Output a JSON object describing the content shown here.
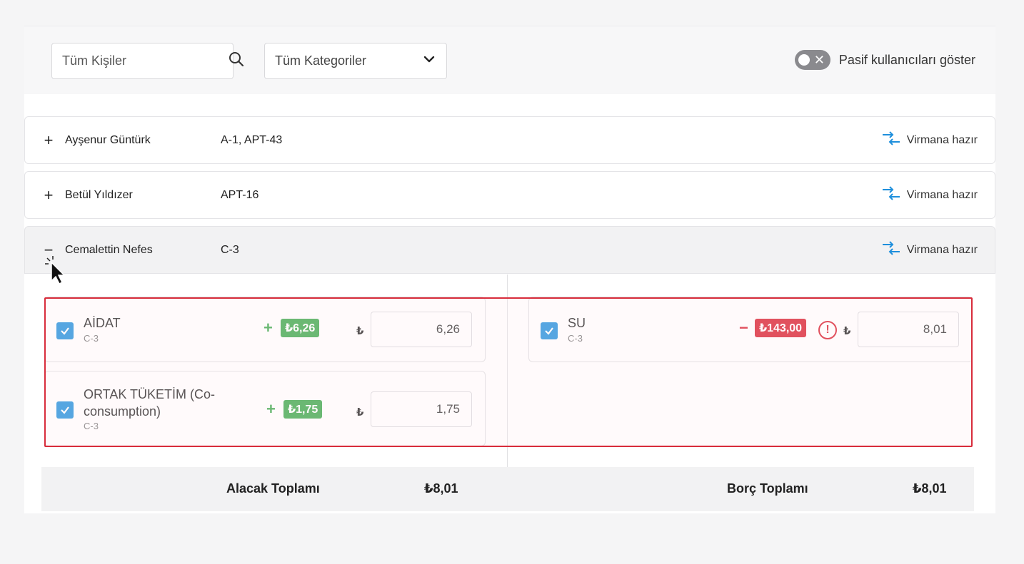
{
  "filters": {
    "search_placeholder": "Tüm Kişiler",
    "category_selected": "Tüm Kategoriler",
    "passive_toggle_label": "Pasif kullanıcıları göster",
    "passive_toggle_on": false
  },
  "rows": [
    {
      "toggle": "+",
      "name": "Ayşenur Güntürk",
      "units": "A-1, APT-43",
      "status": "Virmana hazır",
      "expanded": false
    },
    {
      "toggle": "+",
      "name": "Betül Yıldızer",
      "units": "APT-16",
      "status": "Virmana hazır",
      "expanded": false
    },
    {
      "toggle": "−",
      "name": "Cemalettin Nefes",
      "units": "C-3",
      "status": "Virmana hazır",
      "expanded": true
    }
  ],
  "detail": {
    "left_items": [
      {
        "title": "AİDAT",
        "sub": "C-3",
        "sign": "+",
        "badge": "₺6,26",
        "currency": "₺",
        "amount": "6,26",
        "checked": true
      },
      {
        "title_line1": "ORTAK TÜKETİM (Co-",
        "title_line2": "consumption)",
        "sub": "C-3",
        "sign": "+",
        "badge": "₺1,75",
        "currency": "₺",
        "amount": "1,75",
        "checked": true
      }
    ],
    "right_items": [
      {
        "title": "SU",
        "sub": "C-3",
        "sign": "−",
        "badge": "₺143,00",
        "warning": "!",
        "currency": "₺",
        "amount": "8,01",
        "checked": true
      }
    ],
    "totals": {
      "credit_label": "Alacak Toplamı",
      "credit_value": "₺8,01",
      "debit_label": "Borç Toplamı",
      "debit_value": "₺8,01"
    }
  },
  "colors": {
    "accent": "#1e8fdc",
    "positive": "#3aa74a",
    "negative": "#d71e2e"
  }
}
